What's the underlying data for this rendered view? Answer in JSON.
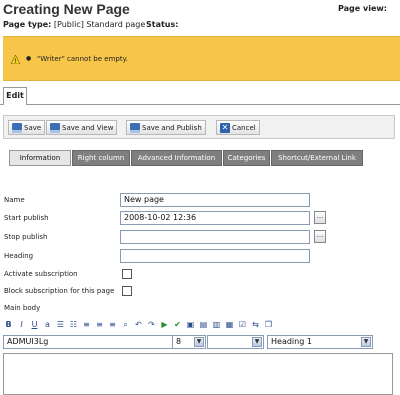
{
  "header": {
    "title": "Creating New Page",
    "page_view_label": "Page view:",
    "page_type_label": "Page type:",
    "page_type_value": "[Public] Standard page",
    "status_label": "Status:"
  },
  "warning": {
    "message": "\"Writer\" cannot be empty.",
    "color": "#f7c54a"
  },
  "edit_tab": {
    "label": "Edit"
  },
  "toolbar": {
    "save": "Save",
    "save_and_view": "Save and View",
    "save_and_publish": "Save and Publish",
    "cancel": "Cancel"
  },
  "tabs": [
    "Information",
    "Right column",
    "Advanced Information",
    "Categories",
    "Shortcut/External Link"
  ],
  "form": {
    "name_label": "Name",
    "name_value": "New page",
    "start_publish_label": "Start publish",
    "start_publish_value": "2008-10-02 12:36",
    "stop_publish_label": "Stop publish",
    "stop_publish_value": "",
    "heading_label": "Heading",
    "heading_value": "",
    "activate_subscription_label": "Activate subscription",
    "block_subscription_label": "Block subscription for this page",
    "main_body_label": "Main body",
    "picker_label": "..."
  },
  "editor": {
    "tools": [
      "B",
      "I",
      "U",
      "a",
      "☰",
      "☷",
      "≡",
      "≡",
      "≡",
      "⌕",
      "↶",
      "↷",
      "▶",
      "✔",
      "▣",
      "▤",
      "▥",
      "▦",
      "☑",
      "⇆",
      "❐"
    ],
    "font_value": "ADMUI3Lg",
    "size_value": "8",
    "blank_value": "",
    "format_value": "Heading 1",
    "dropdown_arrow": "▼"
  }
}
